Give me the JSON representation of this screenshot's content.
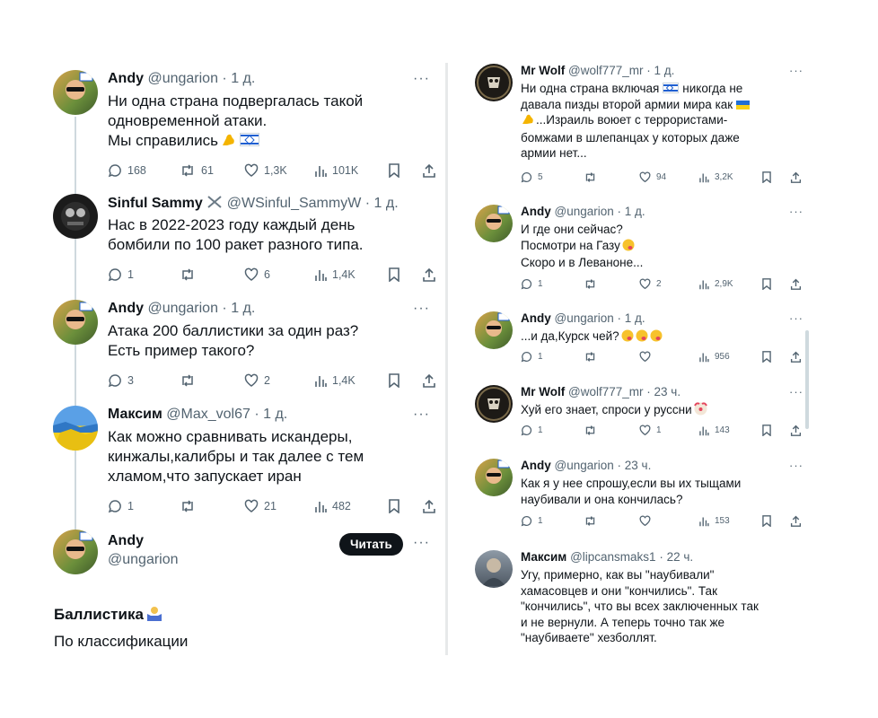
{
  "left": {
    "tweets": [
      {
        "name": "Andy",
        "handle": "@ungarion",
        "time": "· 1 д.",
        "lines": [
          "Ни одна страна подвергалась такой",
          "одновременной атаки.",
          "Мы справились"
        ],
        "stats": {
          "replies": "168",
          "retweets": "61",
          "likes": "1,3K",
          "views": "101K"
        }
      },
      {
        "name": "Sinful Sammy",
        "handle": "@WSinful_SammyW",
        "time": "· 1 д.",
        "lines": [
          "Нас в 2022-2023 году каждый день",
          "бомбили по 100 ракет разного типа."
        ],
        "stats": {
          "replies": "1",
          "retweets": "",
          "likes": "6",
          "views": "1,4K"
        }
      },
      {
        "name": "Andy",
        "handle": "@ungarion",
        "time": "· 1 д.",
        "lines": [
          "Атака 200 баллистики за один раз?",
          "Есть пример такого?"
        ],
        "stats": {
          "replies": "3",
          "retweets": "",
          "likes": "2",
          "views": "1,4K"
        }
      },
      {
        "name": "Максим",
        "handle": "@Max_vol67",
        "time": "· 1 д.",
        "lines": [
          "Как можно сравнивать искандеры,",
          "кинжалы,калибры и так далее с тем",
          "хламом,что запускает иран"
        ],
        "stats": {
          "replies": "1",
          "retweets": "",
          "likes": "21",
          "views": "482"
        }
      }
    ],
    "profile": {
      "name": "Andy",
      "handle": "@ungarion",
      "button": "Читать"
    },
    "post": {
      "title": "Баллистика",
      "subtitle": "По классификации"
    }
  },
  "right": {
    "tweets": [
      {
        "name": "Mr Wolf",
        "handle": "@wolf777_mr",
        "time": "· 1 д.",
        "lines": [
          "Ни одна страна включая",
          "давала пизды второй армии мира как",
          "...Израиль воюет с террористами-",
          "бомжами в шлепанцах у которых даже",
          "армии нет..."
        ],
        "line0_tail": "никогда не",
        "stats": {
          "replies": "5",
          "retweets": "",
          "likes": "94",
          "views": "3,2K"
        }
      },
      {
        "name": "Andy",
        "handle": "@ungarion",
        "time": "· 1 д.",
        "lines": [
          "И где они сейчас?",
          "Посмотри на Газу",
          "Скоро и в Леваноне..."
        ],
        "stats": {
          "replies": "1",
          "retweets": "",
          "likes": "2",
          "views": "2,9K"
        }
      },
      {
        "name": "Andy",
        "handle": "@ungarion",
        "time": "· 1 д.",
        "lines": [
          "...и да,Курск чей?"
        ],
        "stats": {
          "replies": "1",
          "retweets": "",
          "likes": "",
          "views": "956"
        }
      },
      {
        "name": "Mr Wolf",
        "handle": "@wolf777_mr",
        "time": "· 23 ч.",
        "lines": [
          "Хуй его знает, спроси у руссни"
        ],
        "stats": {
          "replies": "1",
          "retweets": "",
          "likes": "1",
          "views": "143"
        }
      },
      {
        "name": "Andy",
        "handle": "@ungarion",
        "time": "· 23 ч.",
        "lines": [
          "Как я у нее спрошу,если вы их тыщами",
          "наубивали и она кончилась?"
        ],
        "stats": {
          "replies": "1",
          "retweets": "",
          "likes": "",
          "views": "153"
        }
      },
      {
        "name": "Максим",
        "handle": "@lipcansmaks1",
        "time": "· 22 ч.",
        "lines": [
          "Угу, примерно, как вы \"наубивали\"",
          "хамасовцев и они \"кончились\". Так",
          "\"кончились\", что вы всех заключенных так",
          "и не вернули. А теперь точно так же",
          "\"наубиваете\" хезболлят."
        ],
        "stats": null
      }
    ]
  },
  "more_glyph": "···",
  "colors": {
    "text": "#0f1419",
    "meta": "#536471",
    "line": "#cfd9de",
    "button": "#0f1419"
  }
}
